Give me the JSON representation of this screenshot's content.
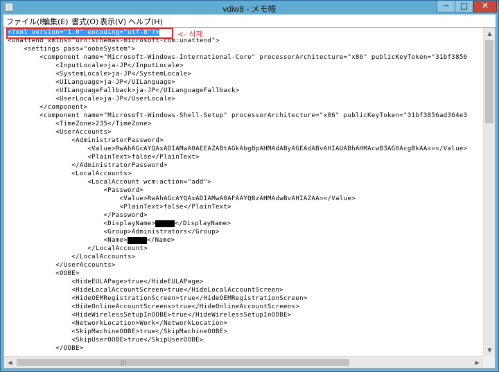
{
  "window": {
    "title": "vdiw8 - メモ帳",
    "min_label": "−",
    "max_label": "□",
    "close_label": "✕"
  },
  "menu": [
    {
      "label": "ファイル(F)"
    },
    {
      "label": "編集(E)"
    },
    {
      "label": "書式(O)"
    },
    {
      "label": "表示(V)"
    },
    {
      "label": "ヘルプ(H)"
    }
  ],
  "annotation": {
    "label": "<- 삭제"
  },
  "editor": {
    "lines": [
      "<?xml version=\"1.0\" encoding=\"utf-8\"?>",
      "<unattend xmlns=\"urn:schemas-microsoft-com:unattend\">",
      "    <settings pass=\"oobeSystem\">",
      "        <component name=\"Microsoft-Windows-International-Core\" processorArchitecture=\"x86\" publicKeyToken=\"31bf3856",
      "            <InputLocale>ja-JP</InputLocale>",
      "            <SystemLocale>ja-JP</SystemLocale>",
      "            <UILanguage>ja-JP</UILanguage>",
      "            <UILanguageFallback>ja-JP</UILanguageFallback>",
      "            <UserLocale>ja-JP</UserLocale>",
      "        </component>",
      "        <component name=\"Microsoft-Windows-Shell-Setup\" processorArchitecture=\"x86\" publicKeyToken=\"31bf3856ad364e3",
      "            <TimeZone>235</TimeZone>",
      "            <UserAccounts>",
      "                <AdministratorPassword>",
      "                    <Value>RwAhAGcAYQAxADIAMwA0AEEAZABtAGkAbgBpAHMAdAByAGEAdABvAHIAUABhAHMAcwB3AG8AcgBkAA==</Value>",
      "                    <PlainText>false</PlainText>",
      "                </AdministratorPassword>",
      "                <LocalAccounts>",
      "                    <LocalAccount wcm:action=\"add\">",
      "                        <Password>",
      "                            <Value>RwAhAGcAYQAxADIAMwA0AFAAYQBzAHMAdwBvAHIAZAA=</Value>",
      "                            <PlainText>false</PlainText>",
      "                        </Password>",
      "                        <DisplayName>",
      "                        <Group>Administrators</Group>",
      "                        <Name>",
      "                    </LocalAccount>",
      "                </LocalAccounts>",
      "            </UserAccounts>",
      "            <OOBE>",
      "                <HideEULAPage>true</HideEULAPage>",
      "                <HideLocalAccountScreen>true</HideLocalAccountScreen>",
      "                <HideOEMRegistrationScreen>true</HideOEMRegistrationScreen>",
      "                <HideOnlineAccountScreens>true</HideOnlineAccountScreens>",
      "                <HideWirelessSetupInOOBE>true</HideWirelessSetupInOOBE>",
      "                <NetworkLocation>Work</NetworkLocation>",
      "                <SkipMachineOOBE>true</SkipMachineOOBE>",
      "                <SkipUserOOBE>true</SkipUserOOBE>",
      "            </OOBE>"
    ],
    "redacted": {
      "display_name_close": "</DisplayName>",
      "name_close": "</Name>"
    }
  }
}
